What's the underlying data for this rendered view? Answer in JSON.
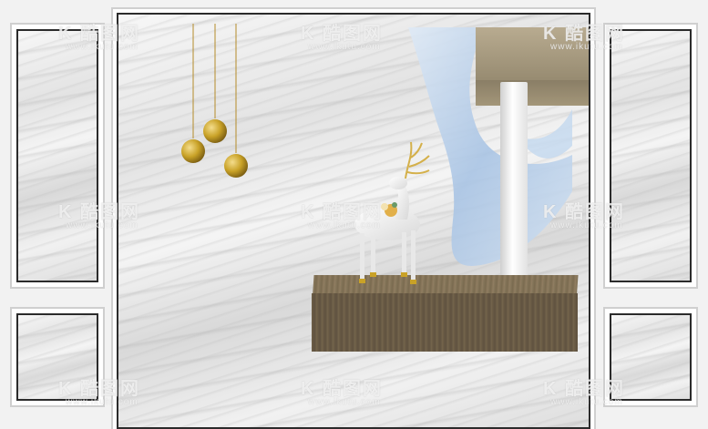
{
  "watermark": {
    "logo_text": "K 酷图网",
    "url_text": "www.ikutu.com"
  },
  "colors": {
    "frame_dark": "#2b2b2b",
    "frame_white": "#ffffff",
    "gold": "#c9a227",
    "wood": "#6e5f47",
    "cloth": "#bcd3ec",
    "beam": "#a89a7e"
  },
  "icons": [
    "pendant-ball-icon",
    "deer-sculpture-icon"
  ]
}
